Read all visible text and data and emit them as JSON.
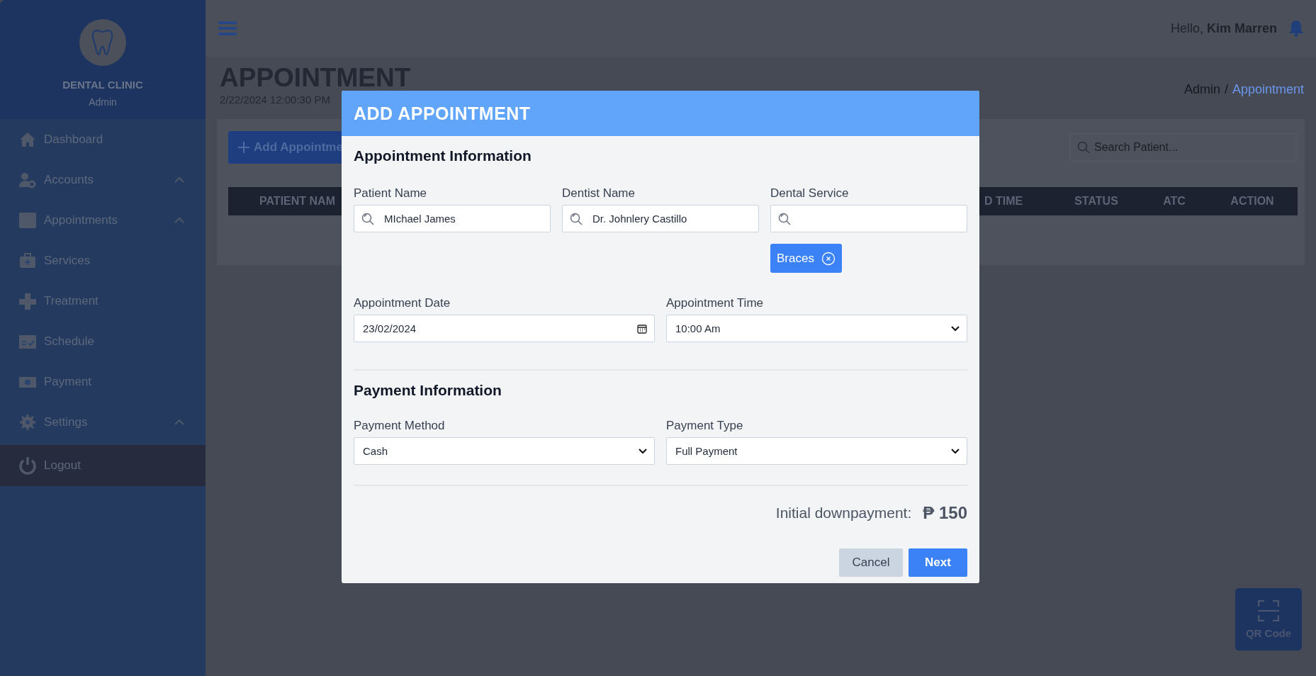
{
  "sidebar": {
    "brand": "DENTAL CLINIC",
    "role": "Admin",
    "items": [
      {
        "label": "Dashboard",
        "has_submenu": false
      },
      {
        "label": "Accounts",
        "has_submenu": true
      },
      {
        "label": "Appointments",
        "has_submenu": true
      },
      {
        "label": "Services",
        "has_submenu": false
      },
      {
        "label": "Treatment",
        "has_submenu": false
      },
      {
        "label": "Schedule",
        "has_submenu": false
      },
      {
        "label": "Payment",
        "has_submenu": false
      },
      {
        "label": "Settings",
        "has_submenu": true
      }
    ],
    "logout": "Logout"
  },
  "topbar": {
    "greeting": "Hello, **Kim Marren**"
  },
  "page": {
    "title": "APPOINTMENT",
    "datetime": "2/22/2024 12:00:30 PM",
    "breadcrumb": [
      {
        "label": "Admin",
        "current": false
      },
      {
        "label": "Appointment",
        "current": true
      }
    ],
    "breadcrumb_separator": "/"
  },
  "card": {
    "add_button": "Add Appointme",
    "search": {
      "placeholder": "Search Patient..."
    },
    "columns_left": [
      "PATIENT NAM"
    ],
    "columns_right": [
      "D TIME",
      "STATUS",
      "ATC",
      "ACTION"
    ]
  },
  "qr_button": "QR Code",
  "modal": {
    "title": "ADD APPOINTMENT",
    "appointment_section": "Appointment Information",
    "patient_name": {
      "label": "Patient Name",
      "value": "MIchael  James"
    },
    "dentist_name": {
      "label": "Dentist Name",
      "value": "Dr. Johnlery Castillo"
    },
    "dental_service": {
      "label": "Dental Service",
      "chips": [
        "Braces"
      ]
    },
    "appointment_date": {
      "label": "Appointment Date",
      "value": "23/02/2024"
    },
    "appointment_time": {
      "label": "Appointment Time",
      "value": "10:00 Am"
    },
    "payment_section": "Payment Information",
    "payment_method": {
      "label": "Payment Method",
      "value": "Cash"
    },
    "payment_type": {
      "label": "Payment Type",
      "value": "Full Payment"
    },
    "downpayment_label": "Initial downpayment:",
    "downpayment_amount": "₱ 150",
    "buttons": [
      "Cancel",
      "Next"
    ]
  }
}
